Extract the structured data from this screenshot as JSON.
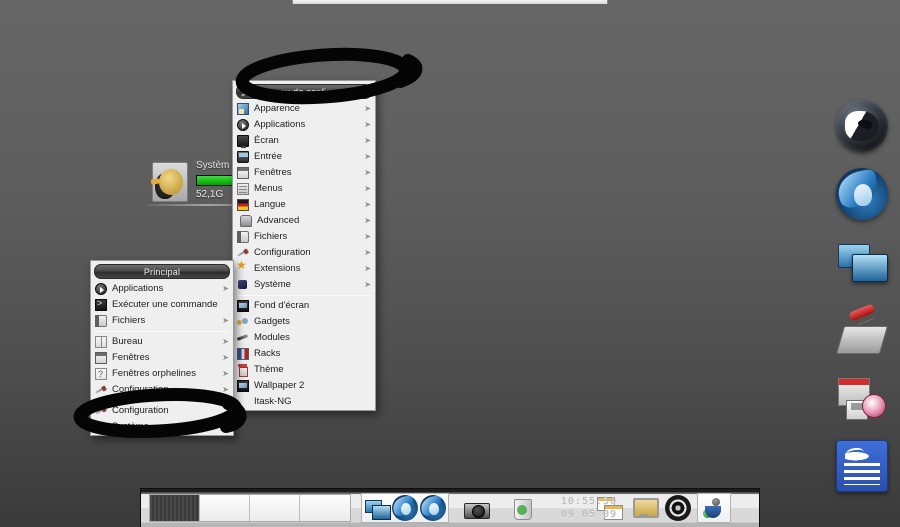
{
  "desktop": {
    "bg_top": "#666666",
    "bg_bottom": "#3a3a3a",
    "environment": "Enlightenment"
  },
  "gadget": {
    "name": "disk-monitor",
    "icon": "hard-disk-penguin-icon",
    "label": "Systèm",
    "size": "52,1G",
    "usage_percent": 100,
    "bar_color": "#00a200"
  },
  "config_menu": {
    "title": "Panneau de configuration",
    "title_icon": "wrench-icon",
    "groups": [
      {
        "items": [
          {
            "label": "Apparence",
            "icon": "appearance-icon",
            "arrow": true
          },
          {
            "label": "Applications",
            "icon": "applications-icon",
            "arrow": true
          },
          {
            "label": "Écran",
            "icon": "screen-icon",
            "arrow": true
          },
          {
            "label": "Entrée",
            "icon": "input-icon",
            "arrow": true
          },
          {
            "label": "Fenêtres",
            "icon": "windows-icon",
            "arrow": true
          },
          {
            "label": "Menus",
            "icon": "menus-icon",
            "arrow": true
          },
          {
            "label": "Langue",
            "icon": "language-flag-icon",
            "arrow": true
          },
          {
            "label": "Advanced",
            "icon": "advanced-icon",
            "arrow": true
          },
          {
            "label": "Fichiers",
            "icon": "files-icon",
            "arrow": true
          },
          {
            "label": "Configuration",
            "icon": "wrench-icon",
            "arrow": true
          },
          {
            "label": "Extensions",
            "icon": "star-icon",
            "arrow": true
          },
          {
            "label": "Système",
            "icon": "system-icon",
            "arrow": true
          }
        ]
      },
      {
        "items": [
          {
            "label": "Fond d'écran",
            "icon": "wallpaper-icon",
            "arrow": false
          },
          {
            "label": "Gadgets",
            "icon": "gadgets-icon",
            "arrow": false
          },
          {
            "label": "Modules",
            "icon": "modules-icon",
            "arrow": false
          },
          {
            "label": "Racks",
            "icon": "racks-icon",
            "arrow": false
          },
          {
            "label": "Thème",
            "icon": "theme-icon",
            "arrow": false
          },
          {
            "label": "Wallpaper 2",
            "icon": "wallpaper-icon",
            "arrow": false
          },
          {
            "label": "Itask-NG",
            "icon": "none",
            "arrow": false
          }
        ]
      }
    ]
  },
  "main_menu": {
    "title": "Principal",
    "groups": [
      {
        "items": [
          {
            "label": "Applications",
            "icon": "applications-icon",
            "arrow": true
          },
          {
            "label": "Exécuter une commande",
            "icon": "run-command-icon",
            "arrow": false
          },
          {
            "label": "Fichiers",
            "icon": "files-icon",
            "arrow": true
          }
        ]
      },
      {
        "items": [
          {
            "label": "Bureau",
            "icon": "desktop-icon",
            "arrow": true
          },
          {
            "label": "Fenêtres",
            "icon": "windows-icon",
            "arrow": true
          },
          {
            "label": "Fenêtres orphelines",
            "icon": "orphan-windows-icon",
            "arrow": true
          },
          {
            "label": "Configuration",
            "icon": "wrench-icon",
            "arrow": true
          }
        ]
      },
      {
        "items": [
          {
            "label": "Configuration",
            "icon": "wrench-icon",
            "arrow": false
          },
          {
            "label": "Système",
            "icon": "system-icon",
            "arrow": true
          }
        ]
      }
    ]
  },
  "dock_right": {
    "items": [
      {
        "name": "wolf-browser-icon",
        "label": ""
      },
      {
        "name": "thunderbird-icon",
        "label": ""
      },
      {
        "name": "screens-icon",
        "label": ""
      },
      {
        "name": "tools-icon",
        "label": ""
      },
      {
        "name": "software-media-icon",
        "label": ""
      },
      {
        "name": "document-editor-icon",
        "label": ""
      }
    ]
  },
  "shelf": {
    "pager": {
      "desktops": 4,
      "active_index": 0
    },
    "tasks": [
      {
        "name": "screens-task-icon"
      },
      {
        "name": "iris-browser-task-icon"
      },
      {
        "name": "iris-browser-task-icon-2"
      }
    ],
    "tray": [
      {
        "name": "camera-icon"
      },
      {
        "name": "trash-icon"
      }
    ],
    "right_icons": [
      {
        "name": "window-list-icon"
      },
      {
        "name": "monitor-icon"
      },
      {
        "name": "speaker-icon"
      },
      {
        "name": "connman-icon"
      }
    ],
    "clock": {
      "time": "10:55:30",
      "date": "09 05 09"
    }
  },
  "annotations": [
    {
      "name": "ellipse-highlight-config-panel-title",
      "target": "Panneau de configuration"
    },
    {
      "name": "ellipse-highlight-configuration-item",
      "target": "Configuration"
    }
  ]
}
